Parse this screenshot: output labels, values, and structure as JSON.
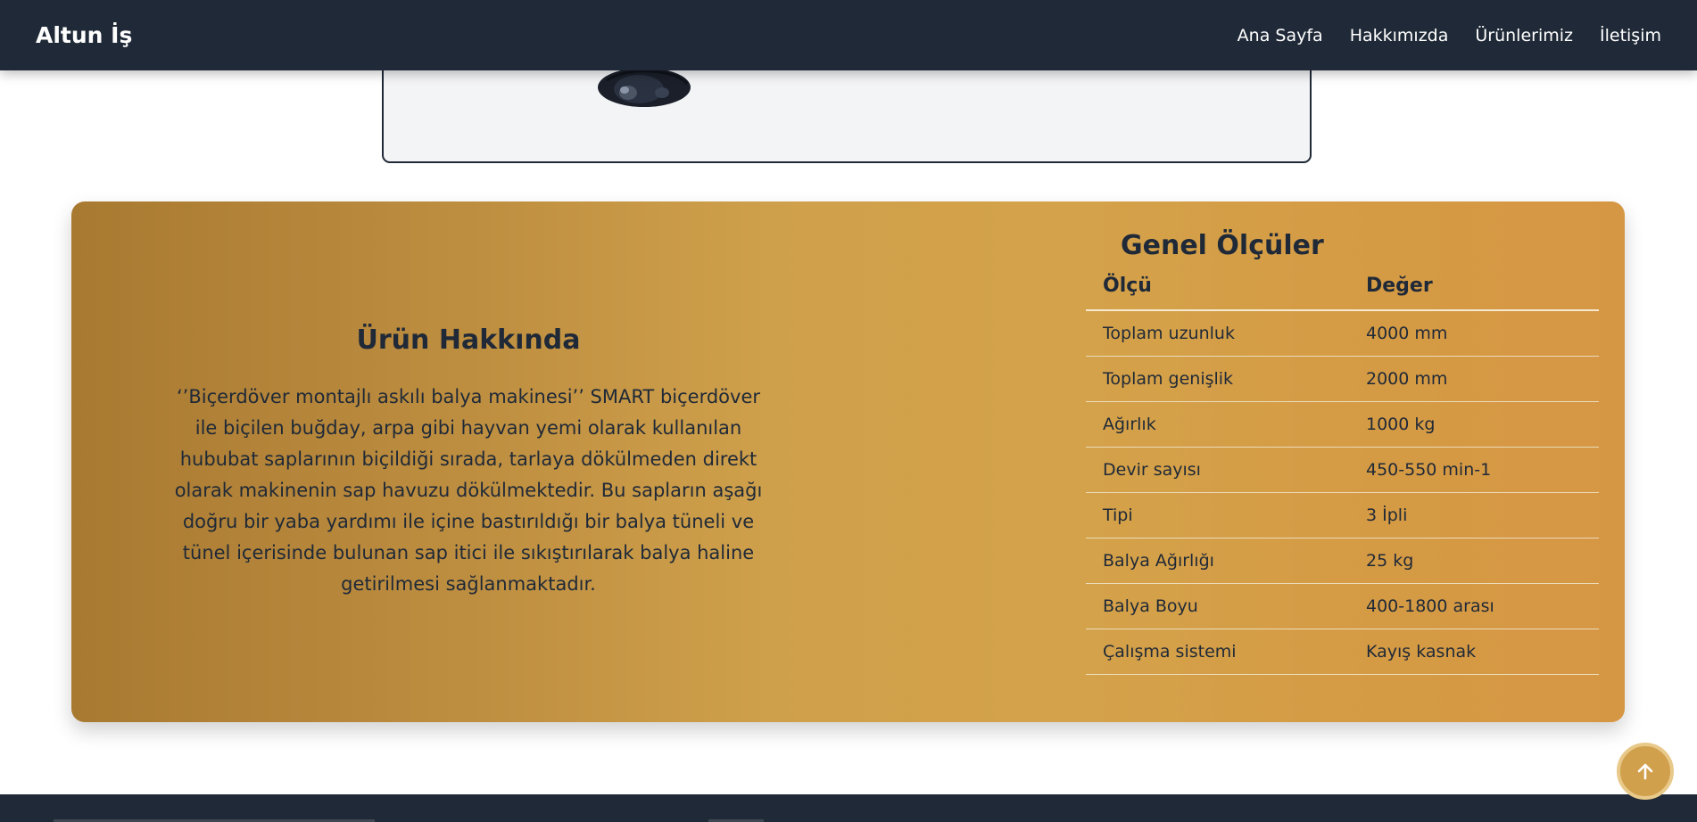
{
  "navbar": {
    "brand": "Altun İş",
    "links": [
      "Ana Sayfa",
      "Hakkımızda",
      "Ürünlerimiz",
      "İletişim"
    ]
  },
  "about": {
    "title": "Ürün Hakkında",
    "text": "‘’Biçerdöver montajlı askılı balya makinesi’’ SMART biçerdöver ile biçilen buğday, arpa gibi hayvan yemi olarak kullanılan hububat saplarının biçildiği sırada, tarlaya dökülmeden direkt olarak makinenin sap havuzu dökülmektedir. Bu sapların aşağı doğru bir yaba yardımı ile içine bastırıldığı bir balya tüneli ve tünel içerisinde bulunan sap itici ile sıkıştırılarak balya haline getirilmesi sağlanmaktadır."
  },
  "specs": {
    "title": "Genel Ölçüler",
    "headers": [
      "Ölçü",
      "Değer"
    ],
    "rows": [
      [
        "Toplam uzunluk",
        "4000 mm"
      ],
      [
        "Toplam genişlik",
        "2000 mm"
      ],
      [
        "Ağırlık",
        "1000 kg"
      ],
      [
        "Devir sayısı",
        "450-550 min-1"
      ],
      [
        "Tipi",
        "3 İpli"
      ],
      [
        "Balya Ağırlığı",
        "25 kg"
      ],
      [
        "Balya Boyu",
        "400-1800 arası"
      ],
      [
        "Çalışma sistemi",
        "Kayış kasnak"
      ]
    ]
  },
  "icons": {
    "scroll_top": "arrow-up-icon",
    "product": "baler-machine-image"
  },
  "colors": {
    "navbar": "#1f2937",
    "card_bg": "#f3f4f6",
    "gradient_start": "#a87a31",
    "gradient_end": "#d69744",
    "scroll_button": "#d1a04d"
  }
}
